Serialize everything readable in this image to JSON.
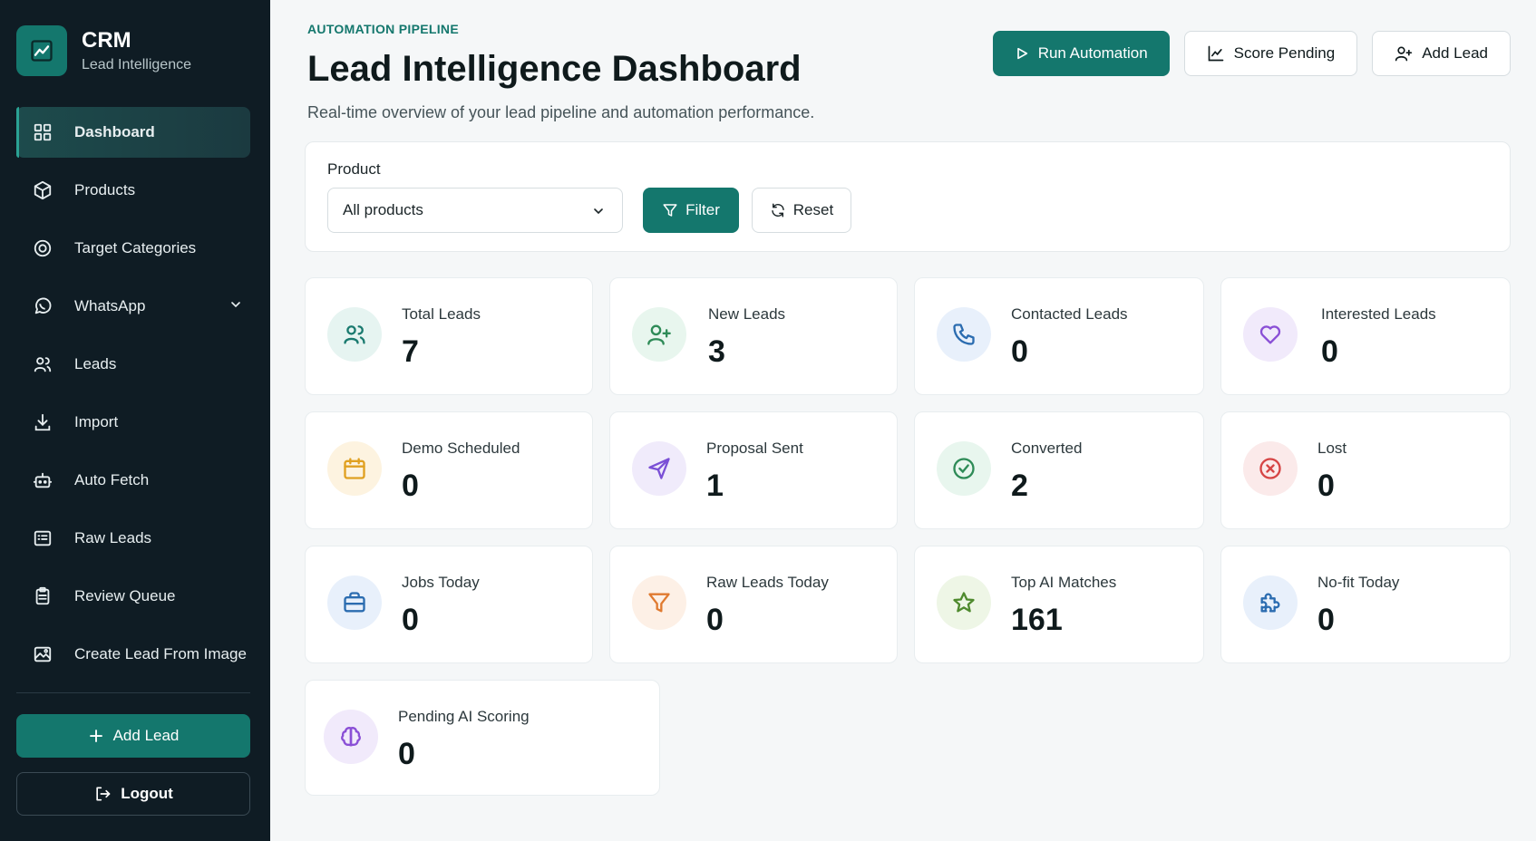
{
  "brand": {
    "title": "CRM",
    "subtitle": "Lead Intelligence"
  },
  "sidebar": {
    "items": [
      {
        "label": "Dashboard",
        "icon": "dashboard-icon"
      },
      {
        "label": "Products",
        "icon": "box-icon"
      },
      {
        "label": "Target Categories",
        "icon": "target-icon"
      },
      {
        "label": "WhatsApp",
        "icon": "whatsapp-icon"
      },
      {
        "label": "Leads",
        "icon": "users-icon"
      },
      {
        "label": "Import",
        "icon": "download-icon"
      },
      {
        "label": "Auto Fetch",
        "icon": "bot-icon"
      },
      {
        "label": "Raw Leads",
        "icon": "list-icon"
      },
      {
        "label": "Review Queue",
        "icon": "clipboard-icon"
      },
      {
        "label": "Create Lead From Image",
        "icon": "image-icon"
      }
    ],
    "add_lead": "Add Lead",
    "logout": "Logout"
  },
  "header": {
    "eyebrow": "AUTOMATION PIPELINE",
    "title": "Lead Intelligence Dashboard",
    "subtitle": "Real-time overview of your lead pipeline and automation performance.",
    "run_automation": "Run Automation",
    "score_pending": "Score Pending",
    "add_lead": "Add Lead"
  },
  "filter": {
    "label": "Product",
    "selected": "All products",
    "filter_button": "Filter",
    "reset_button": "Reset"
  },
  "stats": [
    {
      "label": "Total Leads",
      "value": "7",
      "icon": "users-icon",
      "color": "#1a7a6f",
      "bg": "#e6f4f1"
    },
    {
      "label": "New Leads",
      "value": "3",
      "icon": "user-plus-icon",
      "color": "#2e8b57",
      "bg": "#e8f6ee"
    },
    {
      "label": "Contacted Leads",
      "value": "0",
      "icon": "phone-icon",
      "color": "#2b6cb0",
      "bg": "#e8f0fb"
    },
    {
      "label": "Interested Leads",
      "value": "0",
      "icon": "heart-icon",
      "color": "#8a4fd6",
      "bg": "#f1eafb"
    },
    {
      "label": "Demo Scheduled",
      "value": "0",
      "icon": "calendar-icon",
      "color": "#e0a020",
      "bg": "#fdf3e0"
    },
    {
      "label": "Proposal Sent",
      "value": "1",
      "icon": "send-icon",
      "color": "#7a4fd6",
      "bg": "#f0ebfb"
    },
    {
      "label": "Converted",
      "value": "2",
      "icon": "check-circle-icon",
      "color": "#2e8b57",
      "bg": "#e8f6ee"
    },
    {
      "label": "Lost",
      "value": "0",
      "icon": "x-circle-icon",
      "color": "#d64545",
      "bg": "#fbeaea"
    },
    {
      "label": "Jobs Today",
      "value": "0",
      "icon": "briefcase-icon",
      "color": "#2b6cb0",
      "bg": "#e8f0fb"
    },
    {
      "label": "Raw Leads Today",
      "value": "0",
      "icon": "funnel-icon",
      "color": "#e07a30",
      "bg": "#fdf0e6"
    },
    {
      "label": "Top AI Matches",
      "value": "161",
      "icon": "star-icon",
      "color": "#4f8a2e",
      "bg": "#eef6e6"
    },
    {
      "label": "No-fit Today",
      "value": "0",
      "icon": "puzzle-icon",
      "color": "#2b6cb0",
      "bg": "#e8f0fb"
    },
    {
      "label": "Pending AI Scoring",
      "value": "0",
      "icon": "brain-icon",
      "color": "#8a4fd6",
      "bg": "#f1eafb"
    }
  ]
}
